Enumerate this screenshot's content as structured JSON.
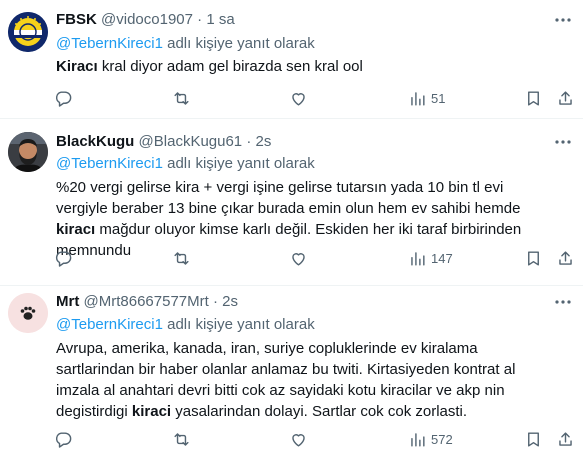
{
  "tweets": [
    {
      "name": "FBSK",
      "handle": "@vidoco1907",
      "dot": "·",
      "time": "1 sa",
      "reply_mention": "@TebernKireci1",
      "reply_suffix": " adlı kişiye yanıt olarak",
      "body_bold": "Kiracı",
      "body_rest": " kral diyor adam gel birazda sen kral ool",
      "views": "51",
      "avatar": "fenerbahce-crest"
    },
    {
      "name": "BlackKugu",
      "handle": "@BlackKugu61",
      "dot": "·",
      "time": "2s",
      "reply_mention": "@TebernKireci1",
      "reply_suffix": " adlı kişiye yanıt olarak",
      "body_pre": "%20 vergi gelirse kira + vergi işine gelirse tutarsın yada  10 bin tl evi vergiyle beraber 13 bine çıkar burada emin olun hem ev sahibi hemde ",
      "body_bold": "kiracı",
      "body_post": " mağdur oluyor kimse karlı değil. Eskiden her iki taraf birbirinden memnundu",
      "views": "147",
      "avatar": "bearded-man-photo"
    },
    {
      "name": "Mrt",
      "handle": "@Mrt86667577Mrt",
      "dot": "·",
      "time": "2s",
      "reply_mention": "@TebernKireci1",
      "reply_suffix": " adlı kişiye yanıt olarak",
      "body_pre": "Avrupa, amerika, kanada, iran, suriye coplukle­rinde ev kiralama sartlarindan bir haber olanlar anlamaz bu twiti. Kirtasiyeden kontrat al imzala al anahtari devri bitti cok az sayidaki kotu kiracilar ve akp nin degistirdigi ",
      "body_bold": "kiraci",
      "body_post": " yasalarindan dolayi. Sartlar cok cok zorlasti.",
      "views": "572",
      "avatar": "paw-print"
    }
  ],
  "colors": {
    "text": "#0f1419",
    "secondary": "#536471",
    "link": "#1d9bf0",
    "border": "#eff3f4"
  },
  "icons": [
    "more-icon",
    "reply-icon",
    "retweet-icon",
    "like-icon",
    "views-icon",
    "bookmark-icon",
    "share-icon"
  ]
}
